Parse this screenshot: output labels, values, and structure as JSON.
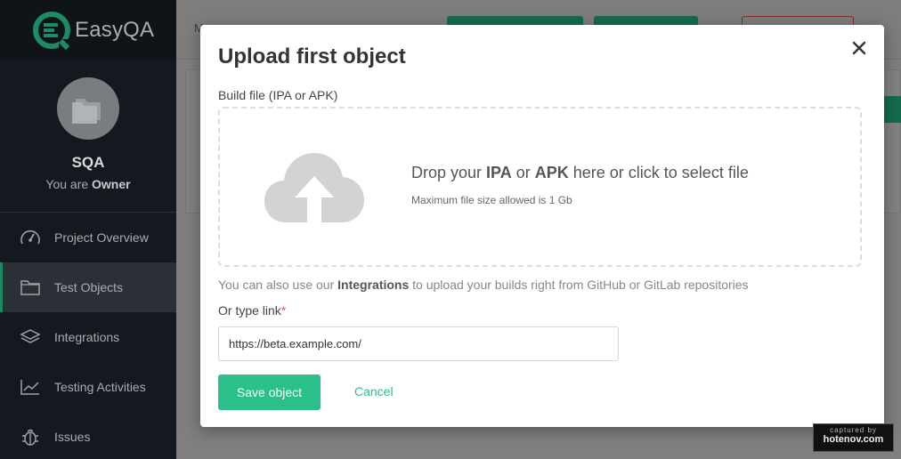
{
  "app": {
    "logo_text": "EasyQA"
  },
  "sidebar": {
    "project_name": "SQA",
    "role_prefix": "You are",
    "role": "Owner",
    "items": [
      {
        "label": "Project Overview",
        "icon": "speedometer-icon"
      },
      {
        "label": "Test Objects",
        "icon": "folder-icon",
        "active": true
      },
      {
        "label": "Integrations",
        "icon": "layers-icon"
      },
      {
        "label": "Testing Activities",
        "icon": "chart-line-icon"
      },
      {
        "label": "Issues",
        "icon": "bug-icon"
      }
    ]
  },
  "background": {
    "breadcrumb": "M..."
  },
  "modal": {
    "title": "Upload first object",
    "build_label": "Build file (IPA or APK)",
    "drop": {
      "pre": "Drop your ",
      "ipa": "IPA",
      "or": " or ",
      "apk": "APK",
      "post": " here or click to select file",
      "subtitle": "Maximum file size allowed is 1 Gb"
    },
    "integrations_note": {
      "pre": "You can also use our ",
      "bold": "Integrations",
      "post": " to upload your builds right from GitHub or GitLab repositories"
    },
    "link_label": "Or type link",
    "required_mark": "*",
    "link_value": "https://beta.example.com/",
    "save_label": "Save object",
    "cancel_label": "Cancel"
  },
  "watermark": {
    "top": "captured by",
    "bottom": "hotenov.com"
  },
  "colors": {
    "accent": "#2bbf8a",
    "sidebar": "#13191e",
    "active_item": "#2a3035"
  }
}
